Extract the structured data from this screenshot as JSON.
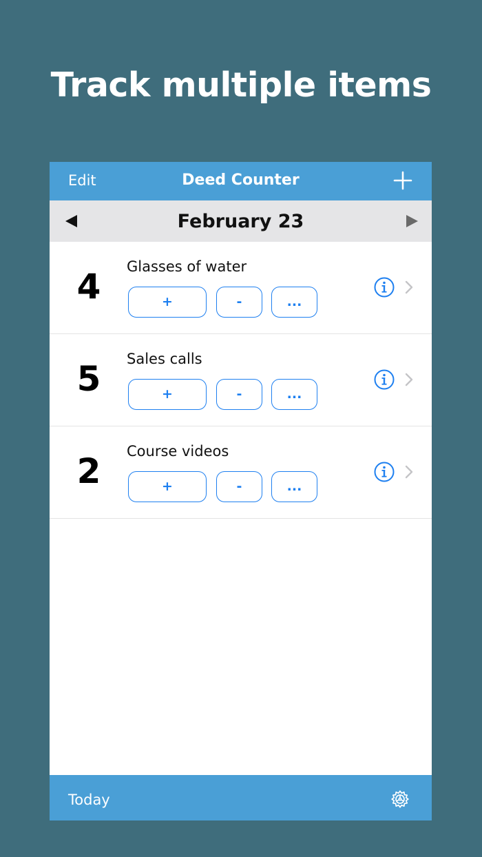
{
  "headline": "Track multiple items",
  "navbar": {
    "edit_label": "Edit",
    "title": "Deed Counter",
    "add_icon": "plus-icon"
  },
  "datebar": {
    "date": "February 23",
    "prev_icon": "triangle-left-icon",
    "next_icon": "triangle-right-icon"
  },
  "items": [
    {
      "count": "4",
      "name": "Glasses of water",
      "plus_label": "+",
      "minus_label": "-",
      "more_label": "..."
    },
    {
      "count": "5",
      "name": "Sales calls",
      "plus_label": "+",
      "minus_label": "-",
      "more_label": "..."
    },
    {
      "count": "2",
      "name": "Course videos",
      "plus_label": "+",
      "minus_label": "-",
      "more_label": "..."
    }
  ],
  "toolbar": {
    "today_label": "Today",
    "settings_icon": "gear-icon"
  },
  "colors": {
    "background": "#3f6d7c",
    "bar": "#4a9fd6",
    "date_bar": "#e5e5e7",
    "accent": "#1d7ff0"
  }
}
